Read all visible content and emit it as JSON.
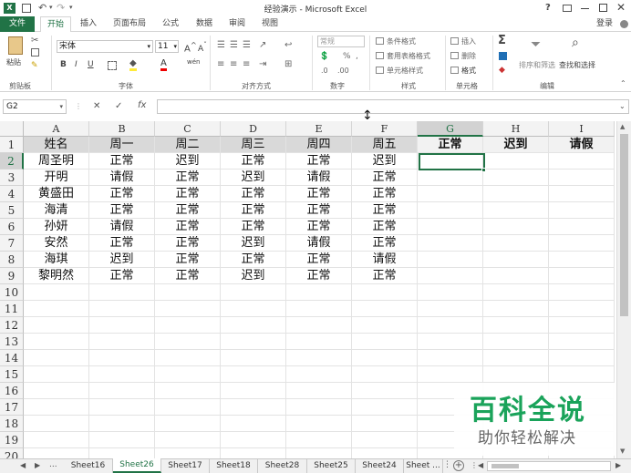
{
  "window": {
    "title": "经验演示 - Microsoft Excel",
    "help": "?",
    "login": "登录"
  },
  "ribbon_tabs": [
    "文件",
    "开始",
    "插入",
    "页面布局",
    "公式",
    "数据",
    "审阅",
    "视图"
  ],
  "ribbon": {
    "paste": "粘贴",
    "clipboard": "剪贴板",
    "font_name": "宋体",
    "font_size": "11",
    "font_group": "字体",
    "align_group": "对齐方式",
    "number_format": "常规",
    "number_group": "数字",
    "cond_format": "条件格式",
    "table_format": "套用表格格式",
    "cell_style": "单元格样式",
    "style_group": "样式",
    "insert": "插入",
    "delete": "删除",
    "format": "格式",
    "cells_group": "单元格",
    "sort_filter": "排序和筛选",
    "find_select": "查找和选择",
    "edit_group": "编辑",
    "bold": "B",
    "italic": "I",
    "underline": "U",
    "wen": "wén"
  },
  "formula_bar": {
    "name_box": "G2",
    "cancel": "✕",
    "enter": "✓",
    "fx": "fx",
    "content": ""
  },
  "grid": {
    "columns": [
      "A",
      "B",
      "C",
      "D",
      "E",
      "F",
      "G",
      "H",
      "I"
    ],
    "rows": [
      "1",
      "2",
      "3",
      "4",
      "5",
      "6",
      "7",
      "8",
      "9",
      "10",
      "11",
      "12",
      "13",
      "14",
      "15",
      "16",
      "17",
      "18",
      "19",
      "20"
    ],
    "data": [
      [
        "姓名",
        "周一",
        "周二",
        "周三",
        "周四",
        "周五",
        "正常",
        "迟到",
        "请假"
      ],
      [
        "周圣明",
        "正常",
        "迟到",
        "正常",
        "正常",
        "迟到",
        "",
        "",
        ""
      ],
      [
        "开明",
        "请假",
        "正常",
        "迟到",
        "请假",
        "正常",
        "",
        "",
        ""
      ],
      [
        "黄盛田",
        "正常",
        "正常",
        "正常",
        "正常",
        "正常",
        "",
        "",
        ""
      ],
      [
        "海清",
        "正常",
        "正常",
        "正常",
        "正常",
        "正常",
        "",
        "",
        ""
      ],
      [
        "孙妍",
        "请假",
        "正常",
        "正常",
        "正常",
        "正常",
        "",
        "",
        ""
      ],
      [
        "安然",
        "正常",
        "正常",
        "迟到",
        "请假",
        "正常",
        "",
        "",
        ""
      ],
      [
        "海琪",
        "迟到",
        "正常",
        "正常",
        "正常",
        "请假",
        "",
        "",
        ""
      ],
      [
        "黎明然",
        "正常",
        "正常",
        "迟到",
        "正常",
        "正常",
        "",
        "",
        ""
      ]
    ],
    "selected_cell": "G2"
  },
  "sheet_tabs": {
    "ellipsis": "...",
    "tabs": [
      "Sheet16",
      "Sheet26",
      "Sheet17",
      "Sheet18",
      "Sheet28",
      "Sheet25",
      "Sheet24",
      "Sheet ..."
    ],
    "active": "Sheet26"
  },
  "watermark": {
    "title": "百科全说",
    "subtitle": "助你轻松解决"
  },
  "colors": {
    "excel_green": "#217346",
    "header_gray": "#d9d9d9",
    "selection": "#217346",
    "watermark_green": "#1aa35a"
  }
}
